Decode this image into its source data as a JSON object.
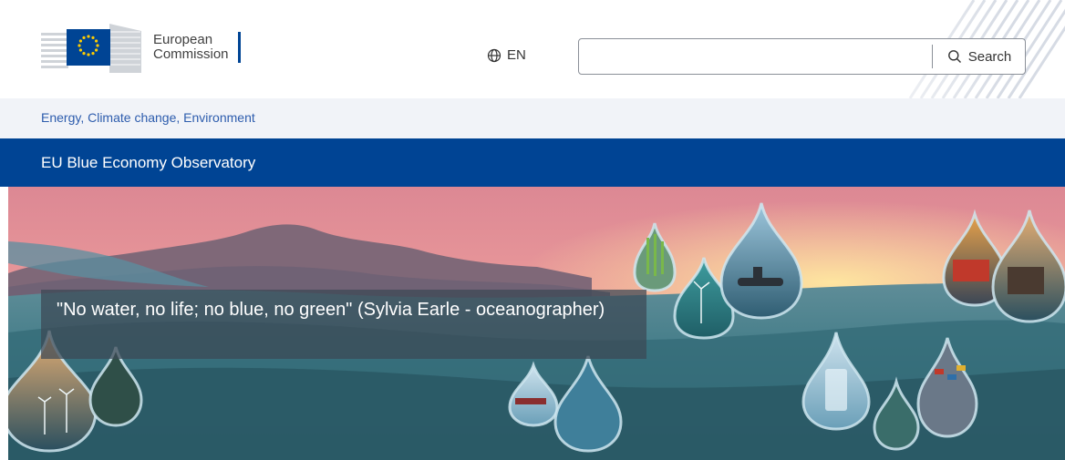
{
  "header": {
    "logo": {
      "line1": "European",
      "line2": "Commission"
    },
    "language": {
      "code": "EN",
      "icon": "globe-icon"
    },
    "search": {
      "value": "",
      "placeholder": "",
      "button_label": "Search",
      "icon": "search-icon"
    }
  },
  "breadcrumb": {
    "link": "Energy, Climate change, Environment"
  },
  "site_title": "EU Blue Economy Observatory",
  "hero": {
    "quote": "\"No water, no life; no blue, no green\" (Sylvia Earle - oceanographer)",
    "drops": [
      "seaweed",
      "turbine",
      "submarine",
      "ship-dock",
      "oil-platform",
      "wind-farm",
      "aquaculture",
      "cargo-ship",
      "harbour",
      "water-glass",
      "fish-farm",
      "container-port"
    ]
  },
  "colors": {
    "brand_blue": "#004494",
    "link_blue": "#2d5cad",
    "breadcrumb_bg": "#f1f3f8",
    "eu_yellow": "#ffcc00"
  }
}
